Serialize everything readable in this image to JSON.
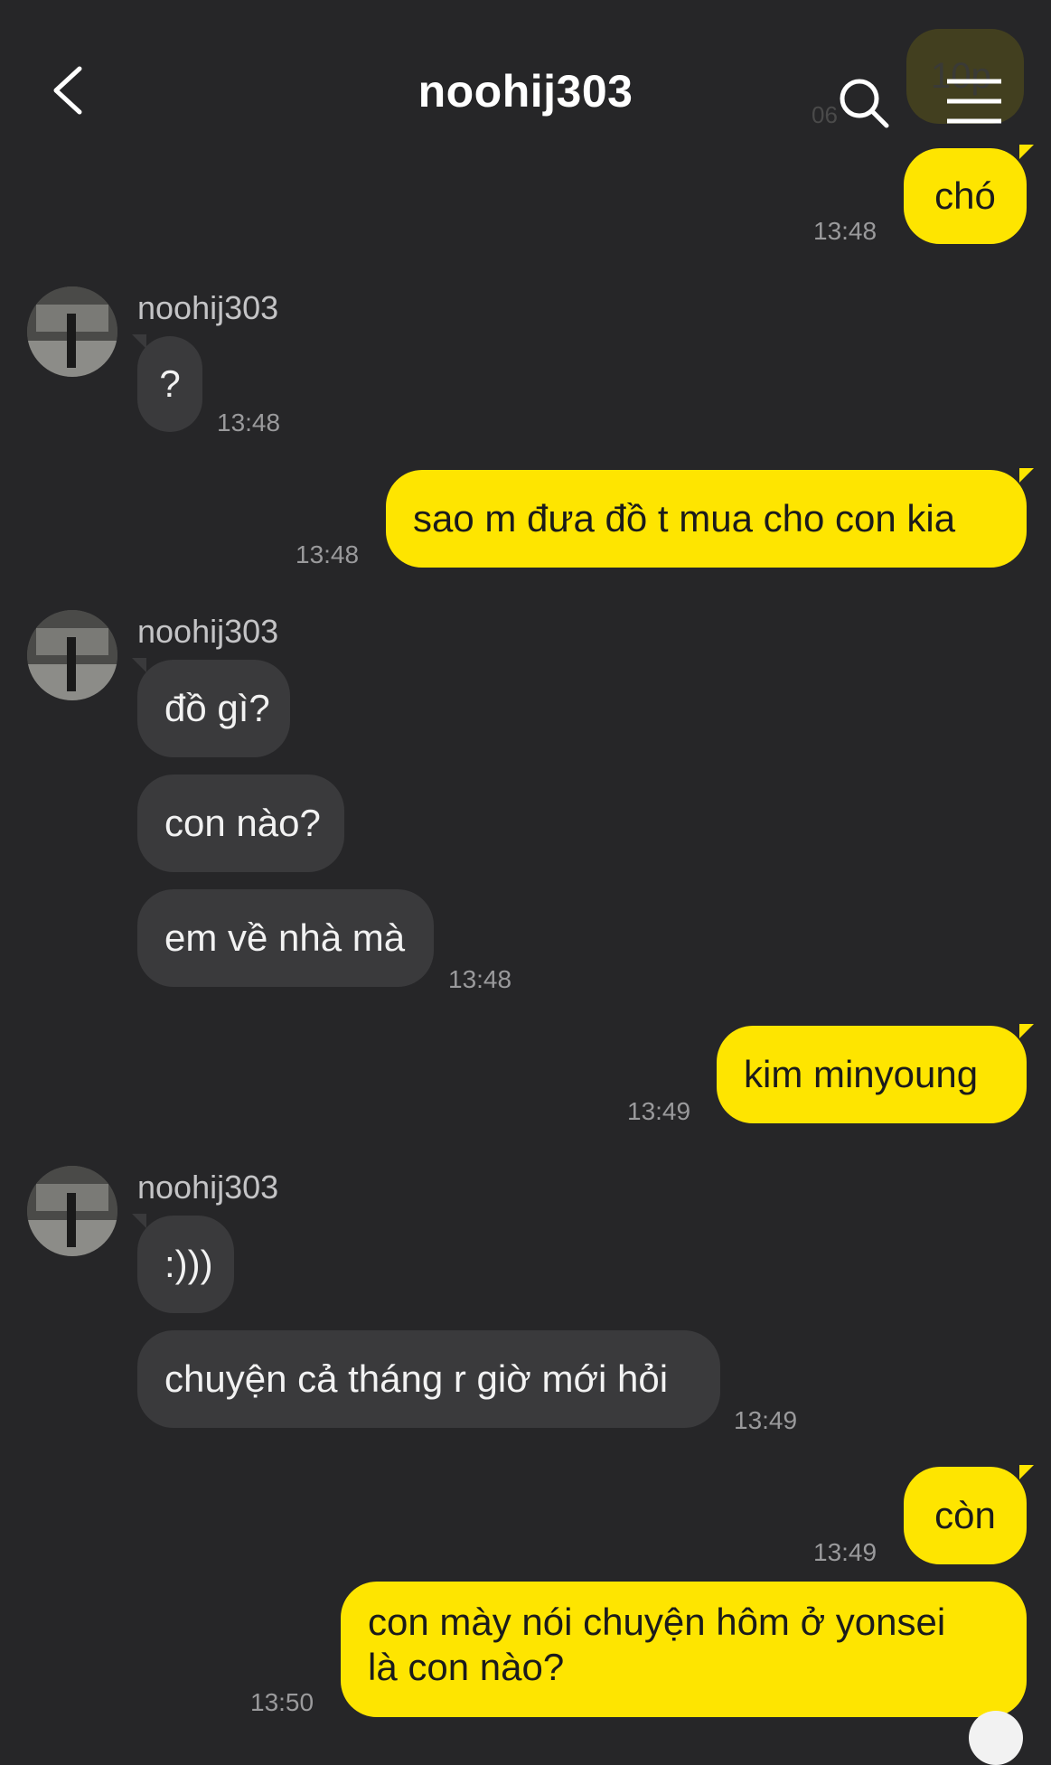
{
  "header": {
    "title": "noohij303"
  },
  "peek": {
    "text": "10p",
    "time": "06"
  },
  "messages": [
    {
      "from": "me",
      "text": "chó",
      "time": "13:48"
    },
    {
      "from": "them",
      "name": "noohij303",
      "text": "?",
      "time": "13:48"
    },
    {
      "from": "me",
      "text": "sao m đưa đồ t mua cho con kia",
      "time": "13:48"
    },
    {
      "from": "them",
      "name": "noohij303",
      "text": "đồ gì?"
    },
    {
      "from": "them",
      "text": "con nào?"
    },
    {
      "from": "them",
      "text": "em về nhà mà",
      "time": "13:48"
    },
    {
      "from": "me",
      "text": "kim minyoung",
      "time": "13:49"
    },
    {
      "from": "them",
      "name": "noohij303",
      "text": ":)))"
    },
    {
      "from": "them",
      "text": "chuyện cả tháng r giờ mới hỏi",
      "time": "13:49"
    },
    {
      "from": "me",
      "text": "còn",
      "time": "13:49"
    },
    {
      "from": "me",
      "text_line1": "con mày nói chuyện hôm ở yonsei",
      "text_line2": "là con nào?",
      "time": "13:50"
    }
  ]
}
